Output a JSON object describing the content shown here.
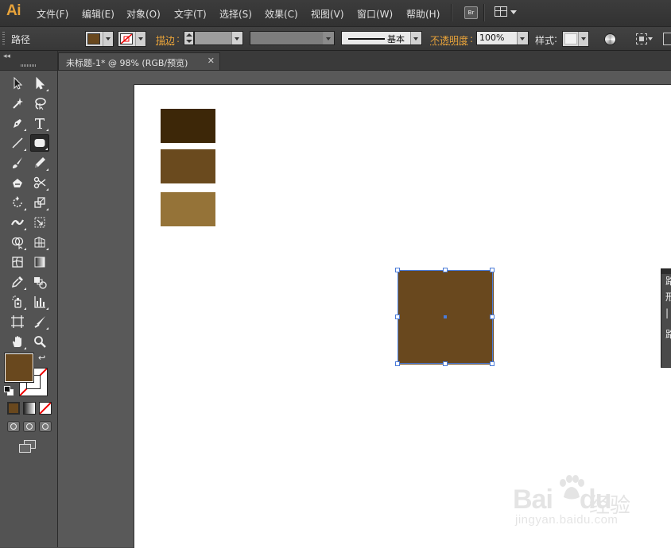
{
  "app": {
    "logo": "Ai"
  },
  "menubar": {
    "items": [
      "文件(F)",
      "编辑(E)",
      "对象(O)",
      "文字(T)",
      "选择(S)",
      "效果(C)",
      "视图(V)",
      "窗口(W)",
      "帮助(H)"
    ],
    "bridge_label": "Br"
  },
  "controlbar": {
    "selection_type": "路径",
    "fill_color": "#69481e",
    "stroke_label": "描边",
    "stroke_profile_label": "基本",
    "opacity_label": "不透明度",
    "opacity_value": "100%",
    "style_label": "样式"
  },
  "document": {
    "tab_title": "未标题-1* @ 98% (RGB/预览)",
    "close_glyph": "✕"
  },
  "artwork": {
    "swatches": [
      {
        "name": "dark-brown",
        "color": "#3d2708"
      },
      {
        "name": "medium-brown",
        "color": "#6a4a1e"
      },
      {
        "name": "light-brown",
        "color": "#957338"
      }
    ],
    "selected_square": {
      "color": "#69481e"
    }
  },
  "tools": {
    "fill_color": "#69481e",
    "stroke_color": "none",
    "active_tool": "rectangle-tool"
  },
  "side_panel": {
    "labels": [
      "路",
      "形",
      "|",
      "路"
    ]
  },
  "watermark": {
    "brand": "Bai",
    "brand_suffix": "du",
    "cn": "经验",
    "url": "jingyan.baidu.com"
  }
}
